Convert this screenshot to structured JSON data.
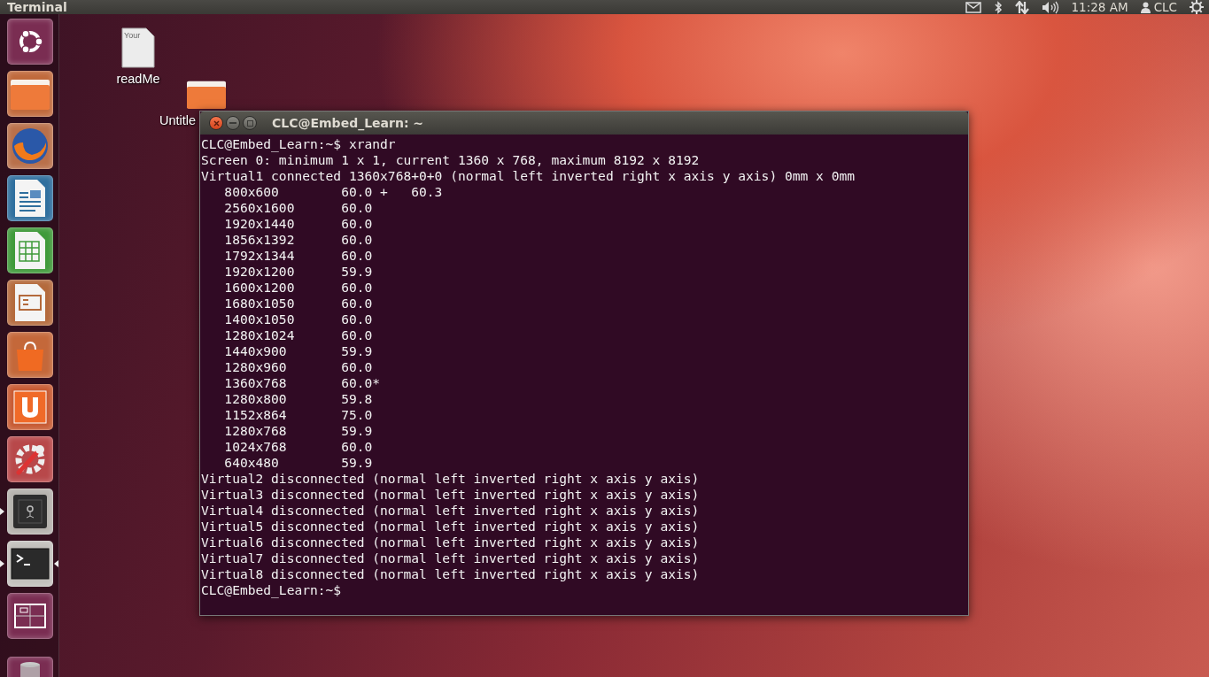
{
  "top_panel": {
    "app_title": "Terminal",
    "clock": "11:28 AM",
    "user": "CLC"
  },
  "launcher": [
    {
      "kind": "dash",
      "running": false,
      "focused": false
    },
    {
      "kind": "files",
      "running": false,
      "focused": false
    },
    {
      "kind": "browser",
      "running": false,
      "focused": false
    },
    {
      "kind": "writer",
      "running": false,
      "focused": false
    },
    {
      "kind": "calc",
      "running": false,
      "focused": false
    },
    {
      "kind": "impress",
      "running": false,
      "focused": false
    },
    {
      "kind": "store",
      "running": false,
      "focused": false
    },
    {
      "kind": "cloud",
      "running": false,
      "focused": false
    },
    {
      "kind": "settings",
      "running": false,
      "focused": false
    },
    {
      "kind": "safe",
      "running": true,
      "focused": false
    },
    {
      "kind": "terminal",
      "running": true,
      "focused": true
    },
    {
      "kind": "workspaces",
      "running": false,
      "focused": false
    },
    {
      "kind": "trash",
      "running": false,
      "focused": false
    }
  ],
  "desktop_icons": [
    {
      "kind": "file",
      "label": "readMe",
      "thumb_text": "Your"
    },
    {
      "kind": "folder",
      "label": "Untitle"
    }
  ],
  "terminal": {
    "title": "CLC@Embed_Learn: ~",
    "lines": [
      "CLC@Embed_Learn:~$ xrandr",
      "Screen 0: minimum 1 x 1, current 1360 x 768, maximum 8192 x 8192",
      "Virtual1 connected 1360x768+0+0 (normal left inverted right x axis y axis) 0mm x 0mm",
      "   800x600        60.0 +   60.3",
      "   2560x1600      60.0",
      "   1920x1440      60.0",
      "   1856x1392      60.0",
      "   1792x1344      60.0",
      "   1920x1200      59.9",
      "   1600x1200      60.0",
      "   1680x1050      60.0",
      "   1400x1050      60.0",
      "   1280x1024      60.0",
      "   1440x900       59.9",
      "   1280x960       60.0",
      "   1360x768       60.0*",
      "   1280x800       59.8",
      "   1152x864       75.0",
      "   1280x768       59.9",
      "   1024x768       60.0",
      "   640x480        59.9",
      "Virtual2 disconnected (normal left inverted right x axis y axis)",
      "Virtual3 disconnected (normal left inverted right x axis y axis)",
      "Virtual4 disconnected (normal left inverted right x axis y axis)",
      "Virtual5 disconnected (normal left inverted right x axis y axis)",
      "Virtual6 disconnected (normal left inverted right x axis y axis)",
      "Virtual7 disconnected (normal left inverted right x axis y axis)",
      "Virtual8 disconnected (normal left inverted right x axis y axis)",
      "CLC@Embed_Learn:~$"
    ]
  }
}
